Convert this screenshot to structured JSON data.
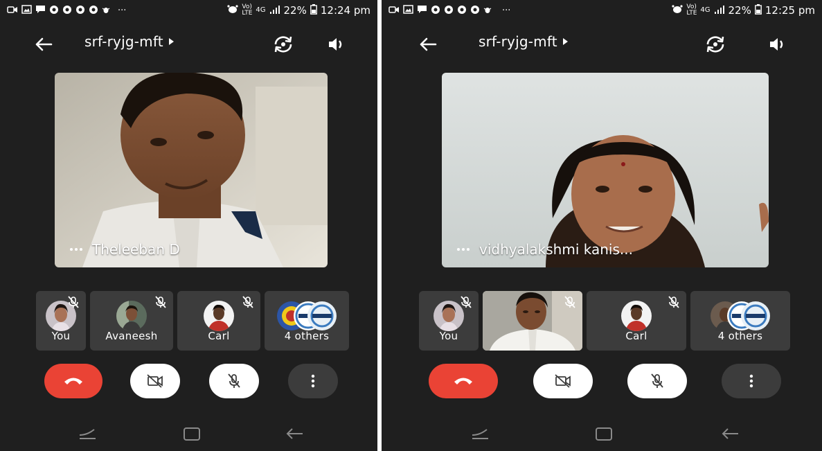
{
  "colors": {
    "background": "#1f1f1f",
    "tile": "#3c3c3c",
    "hangup": "#ea4335",
    "control_light": "#ffffff",
    "control_dark": "#3c3c3c"
  },
  "screens": [
    {
      "status": {
        "battery": "22%",
        "time": "12:24 pm",
        "signal_label": "4G"
      },
      "meeting": {
        "title": "srf-ryjg-mft"
      },
      "active_speaker": {
        "name": "Theleeban D"
      },
      "participants": [
        {
          "name": "You",
          "muted": true
        },
        {
          "name": "Avaneesh",
          "muted": true
        },
        {
          "name": "Carl",
          "muted": true
        },
        {
          "name": "4 others",
          "muted": false
        }
      ],
      "icons": [
        "back-arrow-icon",
        "caret-right-icon",
        "switch-camera-icon",
        "speaker-icon",
        "hang-up-icon",
        "camera-off-icon",
        "mic-off-icon",
        "more-vert-icon"
      ]
    },
    {
      "status": {
        "battery": "22%",
        "time": "12:25 pm",
        "signal_label": "4G"
      },
      "meeting": {
        "title": "srf-ryjg-mft"
      },
      "active_speaker": {
        "name": "vidhyalakshmi kanis..."
      },
      "participants": [
        {
          "name": "You",
          "muted": true
        },
        {
          "name": "",
          "muted": true
        },
        {
          "name": "Carl",
          "muted": true
        },
        {
          "name": "4 others",
          "muted": false
        }
      ],
      "icons": [
        "back-arrow-icon",
        "caret-right-icon",
        "switch-camera-icon",
        "speaker-icon",
        "hang-up-icon",
        "camera-off-icon",
        "mic-off-icon",
        "more-vert-icon"
      ]
    }
  ]
}
